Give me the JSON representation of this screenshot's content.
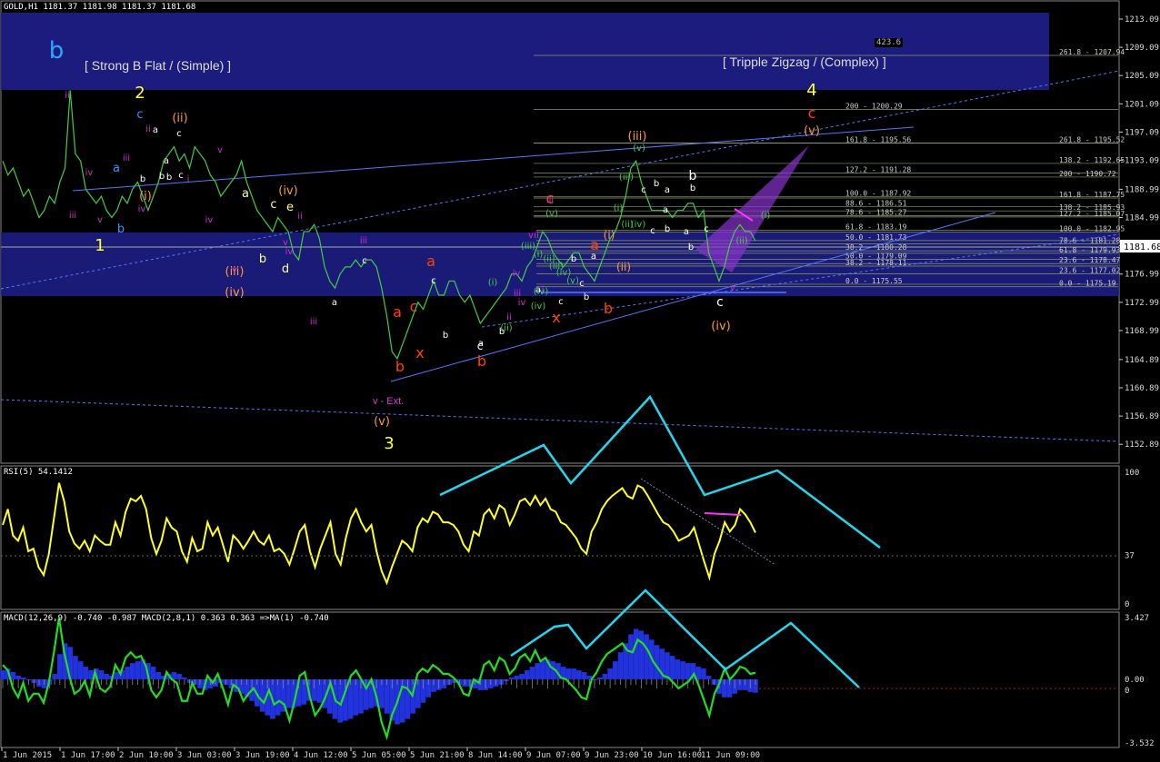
{
  "window": {
    "main_title": "GOLD,H1  1181.37  1181.98  1181.37  1181.68",
    "rsi_title": "RSI(5) 54.1412",
    "macd_title": "MACD(12,26,9) -0.740 -0.987  MACD(2,8,1) 0.363 0.363  =>MA(1) -0.740"
  },
  "annotations": {
    "left_box_label": "[ Strong B Flat / (Simple) ]",
    "right_box_label": "[ Tripple Zigzag / (Complex) ]",
    "fib_top_value": "423.6",
    "v_ext_label": "v - Ext."
  },
  "wave_labels": [
    {
      "text": "b",
      "color": "#29a8ff",
      "size": 26
    },
    {
      "text": "2",
      "color": "#ffff33",
      "size": 18
    },
    {
      "text": "1",
      "color": "#ffff33",
      "size": 18
    },
    {
      "text": "3",
      "color": "#ffff33",
      "size": 18
    },
    {
      "text": "4",
      "color": "#ffff33",
      "size": 18
    },
    {
      "text": "c",
      "color": "#ff4400",
      "size": 16
    },
    {
      "text": "(v)",
      "color": "#ff9933",
      "size": 13
    },
    {
      "text": "(iii)",
      "color": "#ff9933",
      "size": 13
    },
    {
      "text": "(iv)",
      "color": "#ff9933",
      "size": 13
    },
    {
      "text": "(ii)",
      "color": "#ff9933",
      "size": 13
    },
    {
      "text": "(i)",
      "color": "#ff9933",
      "size": 13
    },
    {
      "text": "(iv)",
      "color": "#ff9933",
      "size": 13
    },
    {
      "text": "(iii)",
      "color": "#ff9933",
      "size": 13
    },
    {
      "text": "(v)",
      "color": "#ff9933",
      "size": 13
    },
    {
      "text": "a",
      "color": "#ff4400",
      "size": 16
    },
    {
      "text": "b",
      "color": "#ff4400",
      "size": 16
    },
    {
      "text": "c",
      "color": "#ff4400",
      "size": 16
    },
    {
      "text": "x",
      "color": "#ff4400",
      "size": 16
    },
    {
      "text": "a",
      "color": "#ff4400",
      "size": 16
    },
    {
      "text": "b",
      "color": "#ff4400",
      "size": 16
    },
    {
      "text": "c",
      "color": "#ff4400",
      "size": 16
    },
    {
      "text": "x",
      "color": "#ff4400",
      "size": 16
    },
    {
      "text": "a",
      "color": "#ff4400",
      "size": 16
    },
    {
      "text": "b",
      "color": "#ff4400",
      "size": 16
    },
    {
      "text": "c",
      "color": "#ffffff",
      "size": 14
    },
    {
      "text": "b",
      "color": "#ffffff",
      "size": 14
    },
    {
      "text": "c",
      "color": "#ffffff",
      "size": 12
    },
    {
      "text": "(ii)",
      "color": "#ff9933",
      "size": 12
    },
    {
      "text": "(i)",
      "color": "#ff9933",
      "size": 12
    },
    {
      "text": "(iv)",
      "color": "#ff9933",
      "size": 13
    },
    {
      "text": "e",
      "color": "#ffff99",
      "size": 13
    },
    {
      "text": "c",
      "color": "#ffff99",
      "size": 13
    },
    {
      "text": "d",
      "color": "#ffff99",
      "size": 13
    },
    {
      "text": "b",
      "color": "#ffff99",
      "size": 13
    },
    {
      "text": "a",
      "color": "#ffff99",
      "size": 13
    },
    {
      "text": "c",
      "color": "#3399ff",
      "size": 13
    },
    {
      "text": "a",
      "color": "#3399ff",
      "size": 13
    },
    {
      "text": "b",
      "color": "#3399ff",
      "size": 13
    }
  ],
  "small_labels": [
    {
      "text": "ii",
      "color": "#cc33cc"
    },
    {
      "text": "iii",
      "color": "#cc33cc"
    },
    {
      "text": "iv",
      "color": "#cc33cc"
    },
    {
      "text": "v",
      "color": "#cc33cc"
    },
    {
      "text": "i",
      "color": "#cc33cc"
    },
    {
      "text": "iii",
      "color": "#cc33cc"
    },
    {
      "text": "iv",
      "color": "#cc33cc"
    },
    {
      "text": "ii",
      "color": "#cc33cc"
    },
    {
      "text": "v",
      "color": "#cc33cc"
    },
    {
      "text": "iv",
      "color": "#cc33cc"
    },
    {
      "text": "v",
      "color": "#cc33cc"
    },
    {
      "text": "iii",
      "color": "#cc33cc"
    },
    {
      "text": "iii",
      "color": "#cc33cc"
    },
    {
      "text": "ii",
      "color": "#cc33cc"
    },
    {
      "text": "iv",
      "color": "#cc33cc"
    },
    {
      "text": "v",
      "color": "#cc33cc"
    },
    {
      "text": "ii",
      "color": "#cc33cc"
    },
    {
      "text": "iii",
      "color": "#cc33cc"
    },
    {
      "text": "iv",
      "color": "#cc33cc"
    },
    {
      "text": "v",
      "color": "#cc33cc"
    },
    {
      "text": "i",
      "color": "#cc33cc"
    },
    {
      "text": "ii",
      "color": "#cc33cc"
    },
    {
      "text": "iii",
      "color": "#cc33cc"
    },
    {
      "text": "iv",
      "color": "#cc33cc"
    },
    {
      "text": "v",
      "color": "#cc33cc"
    }
  ],
  "white_small": [
    "a",
    "c",
    "b",
    "b",
    "a",
    "c",
    "b",
    "c",
    "a",
    "b",
    "c",
    "a",
    "b",
    "a",
    "b",
    "c",
    "b",
    "c",
    "a",
    "b",
    "c",
    "b",
    "a",
    "b",
    "a",
    "c",
    "b",
    "a",
    "c"
  ],
  "green_small": [
    "(i)",
    "(ii)",
    "(iii)",
    "(iv)",
    "(v)",
    "(i)",
    "(ii)",
    "(iii)",
    "(iv)",
    "(v)",
    "(i)",
    "(ii)",
    "(iii)",
    "(iv)",
    "(v)",
    "(i)",
    "(ii)",
    "(iv)"
  ],
  "fib_levels": [
    {
      "label": "261.8 - 1207.94",
      "price": 1207.94,
      "color": "#8a9a6a"
    },
    {
      "label": "200 - 1200.29",
      "price": 1200.29,
      "color": "#8a9a6a"
    },
    {
      "label": "261.8 - 1195.52",
      "price": 1195.52,
      "color": "#8a9a6a"
    },
    {
      "label": "161.8 - 1195.56",
      "price": 1195.56,
      "color": "#8a9a6a"
    },
    {
      "label": "138.2 - 1192.65",
      "price": 1192.65,
      "color": "#8a9a6a"
    },
    {
      "label": "127.2 - 1191.28",
      "price": 1191.28,
      "color": "#8a9a6a"
    },
    {
      "label": "200 - 1190.72",
      "price": 1190.72,
      "color": "#8a9a6a"
    },
    {
      "label": "100.0 - 1187.92",
      "price": 1187.92,
      "color": "#8a9a6a"
    },
    {
      "label": "161.8 - 1187.75",
      "price": 1187.75,
      "color": "#8a9a6a"
    },
    {
      "label": "88.6 - 1186.51",
      "price": 1186.51,
      "color": "#8a9a6a"
    },
    {
      "label": "138.2 - 1185.93",
      "price": 1185.93,
      "color": "#8a9a6a"
    },
    {
      "label": "78.6 - 1185.27",
      "price": 1185.27,
      "color": "#8a9a6a"
    },
    {
      "label": "127.2 - 1185.07",
      "price": 1185.07,
      "color": "#8a9a6a"
    },
    {
      "label": "61.8 - 1183.19",
      "price": 1183.19,
      "color": "#8a9a6a"
    },
    {
      "label": "100.0 - 1182.95",
      "price": 1182.95,
      "color": "#8a9a6a"
    },
    {
      "label": "50.0 - 1181.73",
      "price": 1181.73,
      "color": "#8a9a6a"
    },
    {
      "label": "78.6 - 1181.28",
      "price": 1181.28,
      "color": "#8a9a6a"
    },
    {
      "label": "38.2 - 1180.28",
      "price": 1180.28,
      "color": "#8a9a6a"
    },
    {
      "label": "61.8 - 1179.93",
      "price": 1179.93,
      "color": "#8a9a6a"
    },
    {
      "label": "50.0 - 1179.09",
      "price": 1179.09,
      "color": "#8a9a6a"
    },
    {
      "label": "23.6 - 1178.47",
      "price": 1178.47,
      "color": "#8a9a6a"
    },
    {
      "label": "38.2 - 1178.11",
      "price": 1178.11,
      "color": "#8a9a6a"
    },
    {
      "label": "23.6 - 1177.02",
      "price": 1177.02,
      "color": "#8a9a6a"
    },
    {
      "label": "0.0 - 1175.55",
      "price": 1175.55,
      "color": "#8a9a6a"
    },
    {
      "label": "0.0 - 1175.19",
      "price": 1175.19,
      "color": "#8a9a6a"
    }
  ],
  "chart_data": [
    {
      "type": "line",
      "title": "GOLD,H1",
      "ohlc_header": {
        "open": 1181.37,
        "high": 1181.98,
        "low": 1181.37,
        "close": 1181.68
      },
      "current_price": 1181.68,
      "y_axis_ticks": [
        1213.09,
        1209.09,
        1205.09,
        1201.09,
        1197.09,
        1193.09,
        1188.99,
        1184.99,
        1180.99,
        1176.99,
        1172.99,
        1168.99,
        1164.89,
        1160.89,
        1156.89,
        1152.89
      ],
      "ylim": [
        1151.5,
        1214.5
      ],
      "x_axis_ticks": [
        "1 Jun 2015",
        "1 Jun 17:00",
        "2 Jun 10:00",
        "3 Jun 03:00",
        "3 Jun 19:00",
        "4 Jun 12:00",
        "5 Jun 05:00",
        "5 Jun 21:00",
        "8 Jun 14:00",
        "9 Jun 07:00",
        "9 Jun 23:00",
        "10 Jun 16:00",
        "11 Jun 09:00"
      ],
      "series": [
        {
          "values": [
            1193,
            1191,
            1192,
            1190,
            1188,
            1189,
            1187,
            1185,
            1186,
            1188,
            1187,
            1190,
            1192,
            1203,
            1194,
            1193,
            1189,
            1188,
            1187,
            1188,
            1186,
            1185,
            1186,
            1188,
            1187,
            1189,
            1190,
            1188,
            1186,
            1188,
            1190,
            1193,
            1194,
            1195,
            1193,
            1194,
            1192,
            1195,
            1194,
            1193,
            1191,
            1190,
            1188,
            1189,
            1190,
            1191,
            1193,
            1190,
            1188,
            1186,
            1185,
            1184,
            1183,
            1185,
            1184,
            1183,
            1180,
            1179,
            1183,
            1183,
            1184,
            1182,
            1178,
            1176,
            1175,
            1177,
            1178,
            1178,
            1179,
            1178,
            1179,
            1179,
            1178,
            1175,
            1171,
            1166,
            1165,
            1167,
            1169,
            1171,
            1173,
            1172,
            1174,
            1176,
            1174,
            1174,
            1176,
            1176,
            1174,
            1173,
            1174,
            1172,
            1170,
            1171,
            1172,
            1173,
            1174,
            1175,
            1177,
            1177,
            1176,
            1178,
            1179,
            1181,
            1183,
            1182,
            1180,
            1179,
            1178,
            1179,
            1180,
            1180,
            1178,
            1177,
            1176,
            1178,
            1180,
            1182,
            1183,
            1185,
            1188,
            1192,
            1193,
            1190,
            1188,
            1186,
            1186,
            1186,
            1186,
            1185,
            1186,
            1186,
            1187,
            1187,
            1185,
            1186,
            1180,
            1178,
            1176,
            1178,
            1181,
            1183,
            1184,
            1183,
            1183,
            1181.68
          ]
        }
      ]
    },
    {
      "type": "line",
      "title": "RSI(5) 54.1412",
      "y_axis_ticks": [
        100,
        37,
        0
      ],
      "ylim": [
        0,
        100
      ],
      "series": [
        {
          "name": "RSI(5)",
          "values": [
            60,
            72,
            52,
            48,
            58,
            40,
            42,
            28,
            22,
            38,
            65,
            92,
            78,
            55,
            46,
            42,
            48,
            40,
            52,
            48,
            45,
            45,
            62,
            52,
            70,
            80,
            78,
            82,
            72,
            50,
            38,
            48,
            65,
            58,
            55,
            40,
            32,
            50,
            40,
            42,
            62,
            52,
            58,
            45,
            32,
            52,
            48,
            42,
            48,
            55,
            48,
            45,
            52,
            40,
            42,
            38,
            30,
            42,
            55,
            60,
            40,
            28,
            42,
            52,
            62,
            38,
            30,
            50,
            65,
            72,
            62,
            55,
            60,
            40,
            25,
            16,
            28,
            38,
            48,
            45,
            40,
            58,
            65,
            62,
            70,
            68,
            62,
            62,
            60,
            55,
            45,
            40,
            55,
            52,
            68,
            72,
            65,
            75,
            72,
            60,
            68,
            78,
            80,
            75,
            82,
            75,
            80,
            72,
            70,
            62,
            60,
            55,
            50,
            42,
            38,
            55,
            62,
            72,
            78,
            82,
            85,
            88,
            82,
            80,
            90,
            88,
            82,
            75,
            68,
            62,
            60,
            55,
            48,
            50,
            52,
            58,
            45,
            32,
            20,
            38,
            48,
            62,
            55,
            60,
            72,
            68,
            62,
            54.14
          ]
        }
      ]
    },
    {
      "type": "bar",
      "title": "MACD(12,26,9) -0.740 -0.987  MACD(2,8,1) 0.363 0.363  =>MA(1) -0.740",
      "y_axis_ticks": [
        3.427,
        0.0,
        0,
        -3.532
      ],
      "ylim": [
        -3.532,
        3.427
      ],
      "series": [
        {
          "name": "MACD(12,26,9)",
          "values": [
            0.5,
            0.6,
            0.4,
            0.2,
            0.1,
            0.0,
            -0.2,
            -0.4,
            -0.5,
            -0.3,
            0.3,
            1.4,
            2.0,
            1.8,
            1.3,
            1.0,
            0.7,
            0.5,
            0.6,
            0.5,
            0.3,
            0.2,
            0.4,
            0.5,
            0.7,
            0.9,
            1.0,
            1.1,
            0.9,
            0.7,
            0.4,
            0.2,
            0.3,
            0.4,
            0.3,
            0.1,
            -0.2,
            -0.3,
            -0.5,
            -0.6,
            -0.5,
            -0.4,
            -0.2,
            -0.3,
            -0.5,
            -0.7,
            -0.8,
            -1.0,
            -1.2,
            -1.5,
            -1.8,
            -2.0,
            -2.2,
            -2.0,
            -1.8,
            -1.6,
            -1.6,
            -1.5,
            -1.4,
            -1.2,
            -1.2,
            -1.3,
            -1.6,
            -1.9,
            -2.2,
            -2.4,
            -2.3,
            -2.2,
            -2.0,
            -1.9,
            -1.7,
            -1.6,
            -1.5,
            -1.6,
            -1.9,
            -2.3,
            -2.5,
            -2.4,
            -2.2,
            -1.9,
            -1.6,
            -1.3,
            -1.0,
            -0.7,
            -0.6,
            -0.5,
            -0.3,
            -0.2,
            -0.3,
            -0.4,
            -0.4,
            -0.5,
            -0.6,
            -0.6,
            -0.5,
            -0.4,
            -0.3,
            -0.1,
            0.1,
            0.2,
            0.3,
            0.5,
            0.7,
            0.9,
            1.1,
            1.1,
            1.0,
            0.9,
            0.7,
            0.6,
            0.6,
            0.5,
            0.4,
            0.2,
            0.0,
            0.1,
            0.3,
            0.6,
            1.0,
            1.5,
            2.0,
            2.5,
            2.8,
            2.7,
            2.5,
            2.2,
            1.9,
            1.7,
            1.5,
            1.3,
            1.1,
            1.0,
            0.9,
            0.9,
            0.7,
            0.6,
            0.2,
            -0.3,
            -0.8,
            -1.0,
            -1.0,
            -0.8,
            -0.6,
            -0.6,
            -0.7,
            -0.74
          ]
        },
        {
          "name": "MACD(2,8,1)",
          "values": [
            0.8,
            0.5,
            -0.5,
            -1.0,
            -0.2,
            -1.2,
            -0.8,
            -0.8,
            -1.3,
            -0.2,
            1.5,
            3.4,
            1.5,
            0.2,
            -0.8,
            -0.6,
            -0.1,
            -0.9,
            0.4,
            -0.5,
            -0.7,
            -0.4,
            0.8,
            0.3,
            1.2,
            1.5,
            1.2,
            1.3,
            0.7,
            -0.6,
            -1.0,
            -0.6,
            0.4,
            0.0,
            -0.2,
            -1.2,
            -1.2,
            -0.2,
            -0.8,
            -0.8,
            0.2,
            -0.2,
            0.3,
            -0.5,
            -1.4,
            -0.3,
            -0.5,
            -1.2,
            -0.8,
            -0.5,
            -1.0,
            -1.3,
            -0.6,
            -1.4,
            -1.2,
            -1.4,
            -2.3,
            -1.2,
            0.2,
            0.4,
            -1.0,
            -2.0,
            -1.6,
            -1.0,
            -0.2,
            -1.2,
            -1.4,
            -0.6,
            0.2,
            0.5,
            0.0,
            -0.5,
            0.0,
            -1.0,
            -2.4,
            -3.2,
            -2.0,
            -1.3,
            -0.4,
            -0.5,
            -0.9,
            0.3,
            0.6,
            0.4,
            0.8,
            0.6,
            0.3,
            0.3,
            0.1,
            -0.2,
            -0.8,
            -0.9,
            0.0,
            -0.2,
            0.8,
            1.0,
            0.5,
            1.2,
            1.0,
            0.3,
            0.6,
            1.2,
            1.4,
            1.0,
            1.6,
            1.0,
            1.2,
            0.7,
            0.5,
            0.1,
            0.0,
            -0.3,
            -0.6,
            -1.0,
            -1.1,
            0.0,
            0.4,
            1.0,
            1.4,
            1.6,
            1.8,
            2.0,
            1.6,
            1.5,
            2.2,
            2.0,
            1.6,
            1.0,
            0.6,
            0.2,
            0.1,
            -0.2,
            -0.5,
            -0.3,
            -0.1,
            0.3,
            -0.4,
            -1.2,
            -2.0,
            -0.8,
            -0.2,
            0.6,
            0.0,
            0.3,
            0.7,
            0.6,
            0.3,
            0.363
          ]
        }
      ]
    }
  ]
}
